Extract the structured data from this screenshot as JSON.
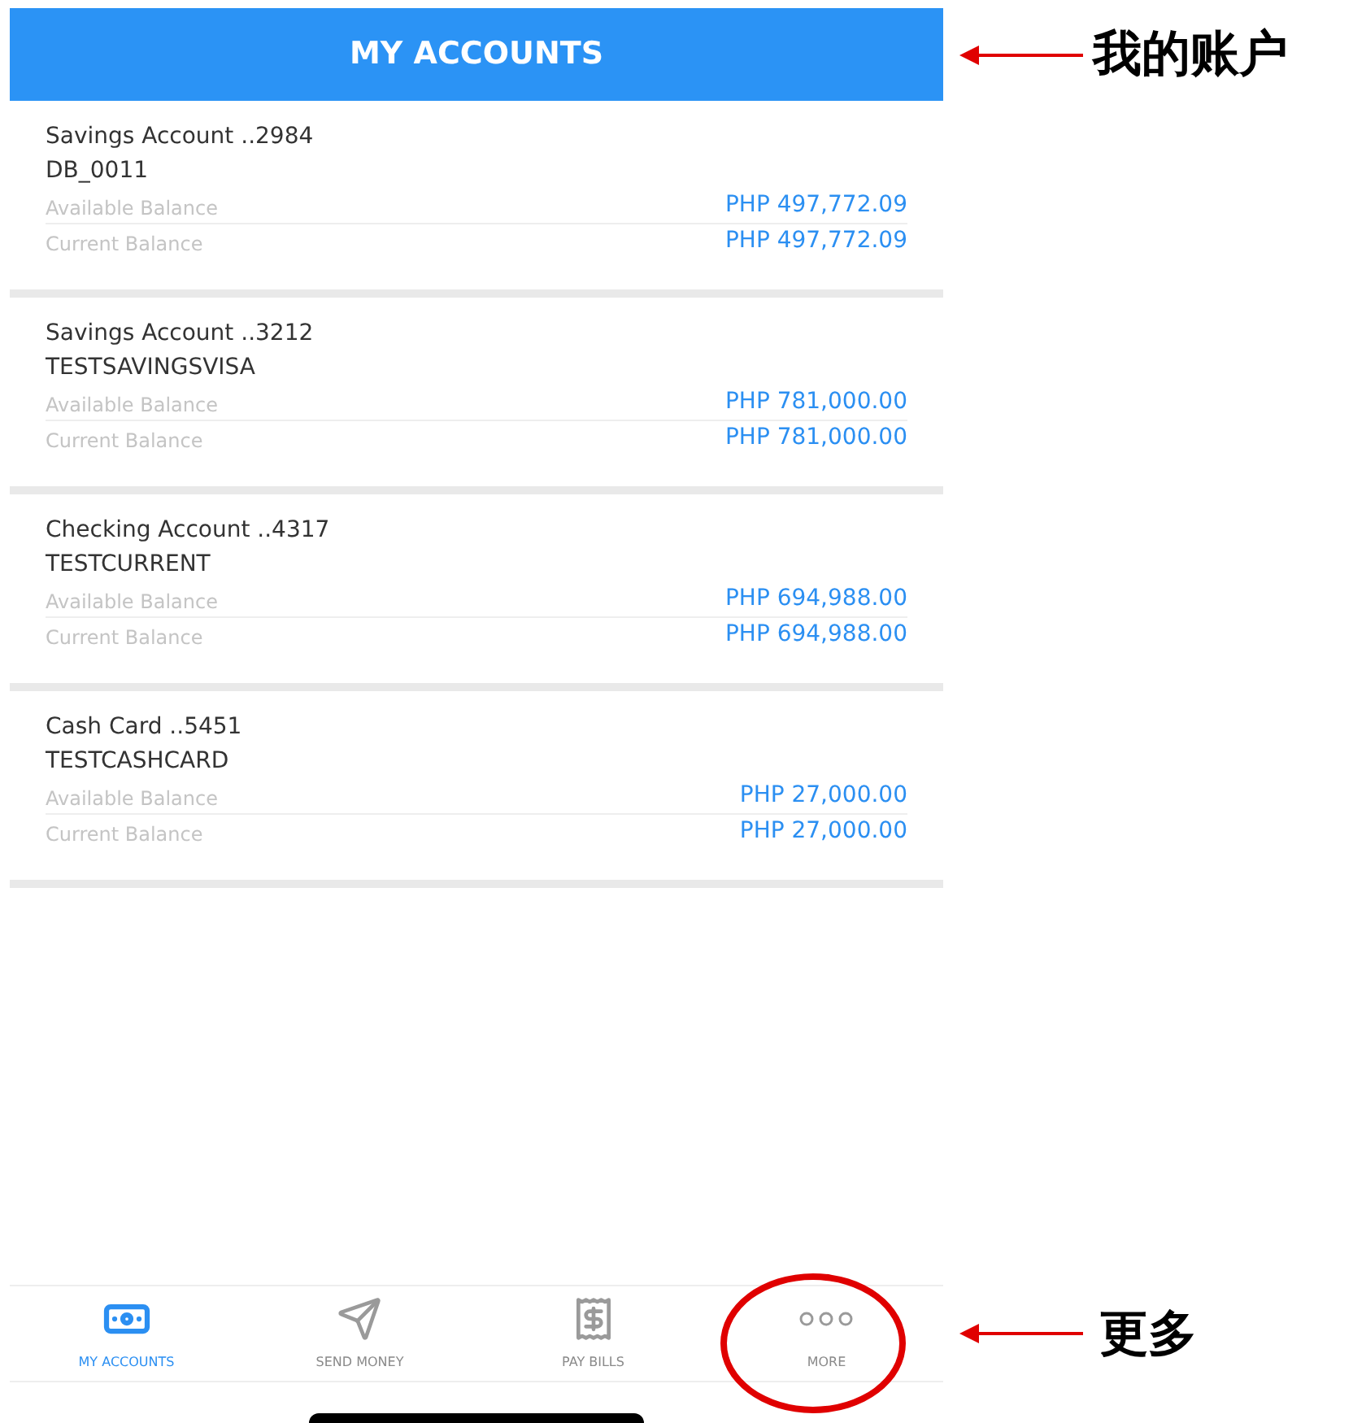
{
  "header": {
    "title": "MY ACCOUNTS"
  },
  "header_annotation": {
    "label": "我的账户"
  },
  "accounts": [
    {
      "name": "Savings Account ..2984",
      "nickname": "DB_0011",
      "available_label": "Available Balance",
      "available": "PHP 497,772.09",
      "current_label": "Current Balance",
      "current": "PHP 497,772.09"
    },
    {
      "name": "Savings Account ..3212",
      "nickname": "TESTSAVINGSVISA",
      "available_label": "Available Balance",
      "available": "PHP 781,000.00",
      "current_label": "Current Balance",
      "current": "PHP 781,000.00"
    },
    {
      "name": "Checking Account ..4317",
      "nickname": "TESTCURRENT",
      "available_label": "Available Balance",
      "available": "PHP 694,988.00",
      "current_label": "Current Balance",
      "current": "PHP 694,988.00"
    },
    {
      "name": "Cash Card ..5451",
      "nickname": "TESTCASHCARD",
      "available_label": "Available Balance",
      "available": "PHP 27,000.00",
      "current_label": "Current Balance",
      "current": "PHP 27,000.00"
    }
  ],
  "nav": [
    {
      "label": "MY ACCOUNTS",
      "kind": "accounts",
      "selected": true,
      "highlighted": false
    },
    {
      "label": "SEND MONEY",
      "kind": "send",
      "selected": false,
      "highlighted": false
    },
    {
      "label": "PAY BILLS",
      "kind": "bills",
      "selected": false,
      "highlighted": false
    },
    {
      "label": "MORE",
      "kind": "more",
      "selected": false,
      "highlighted": true
    }
  ],
  "more_annotation": {
    "label": "更多"
  }
}
